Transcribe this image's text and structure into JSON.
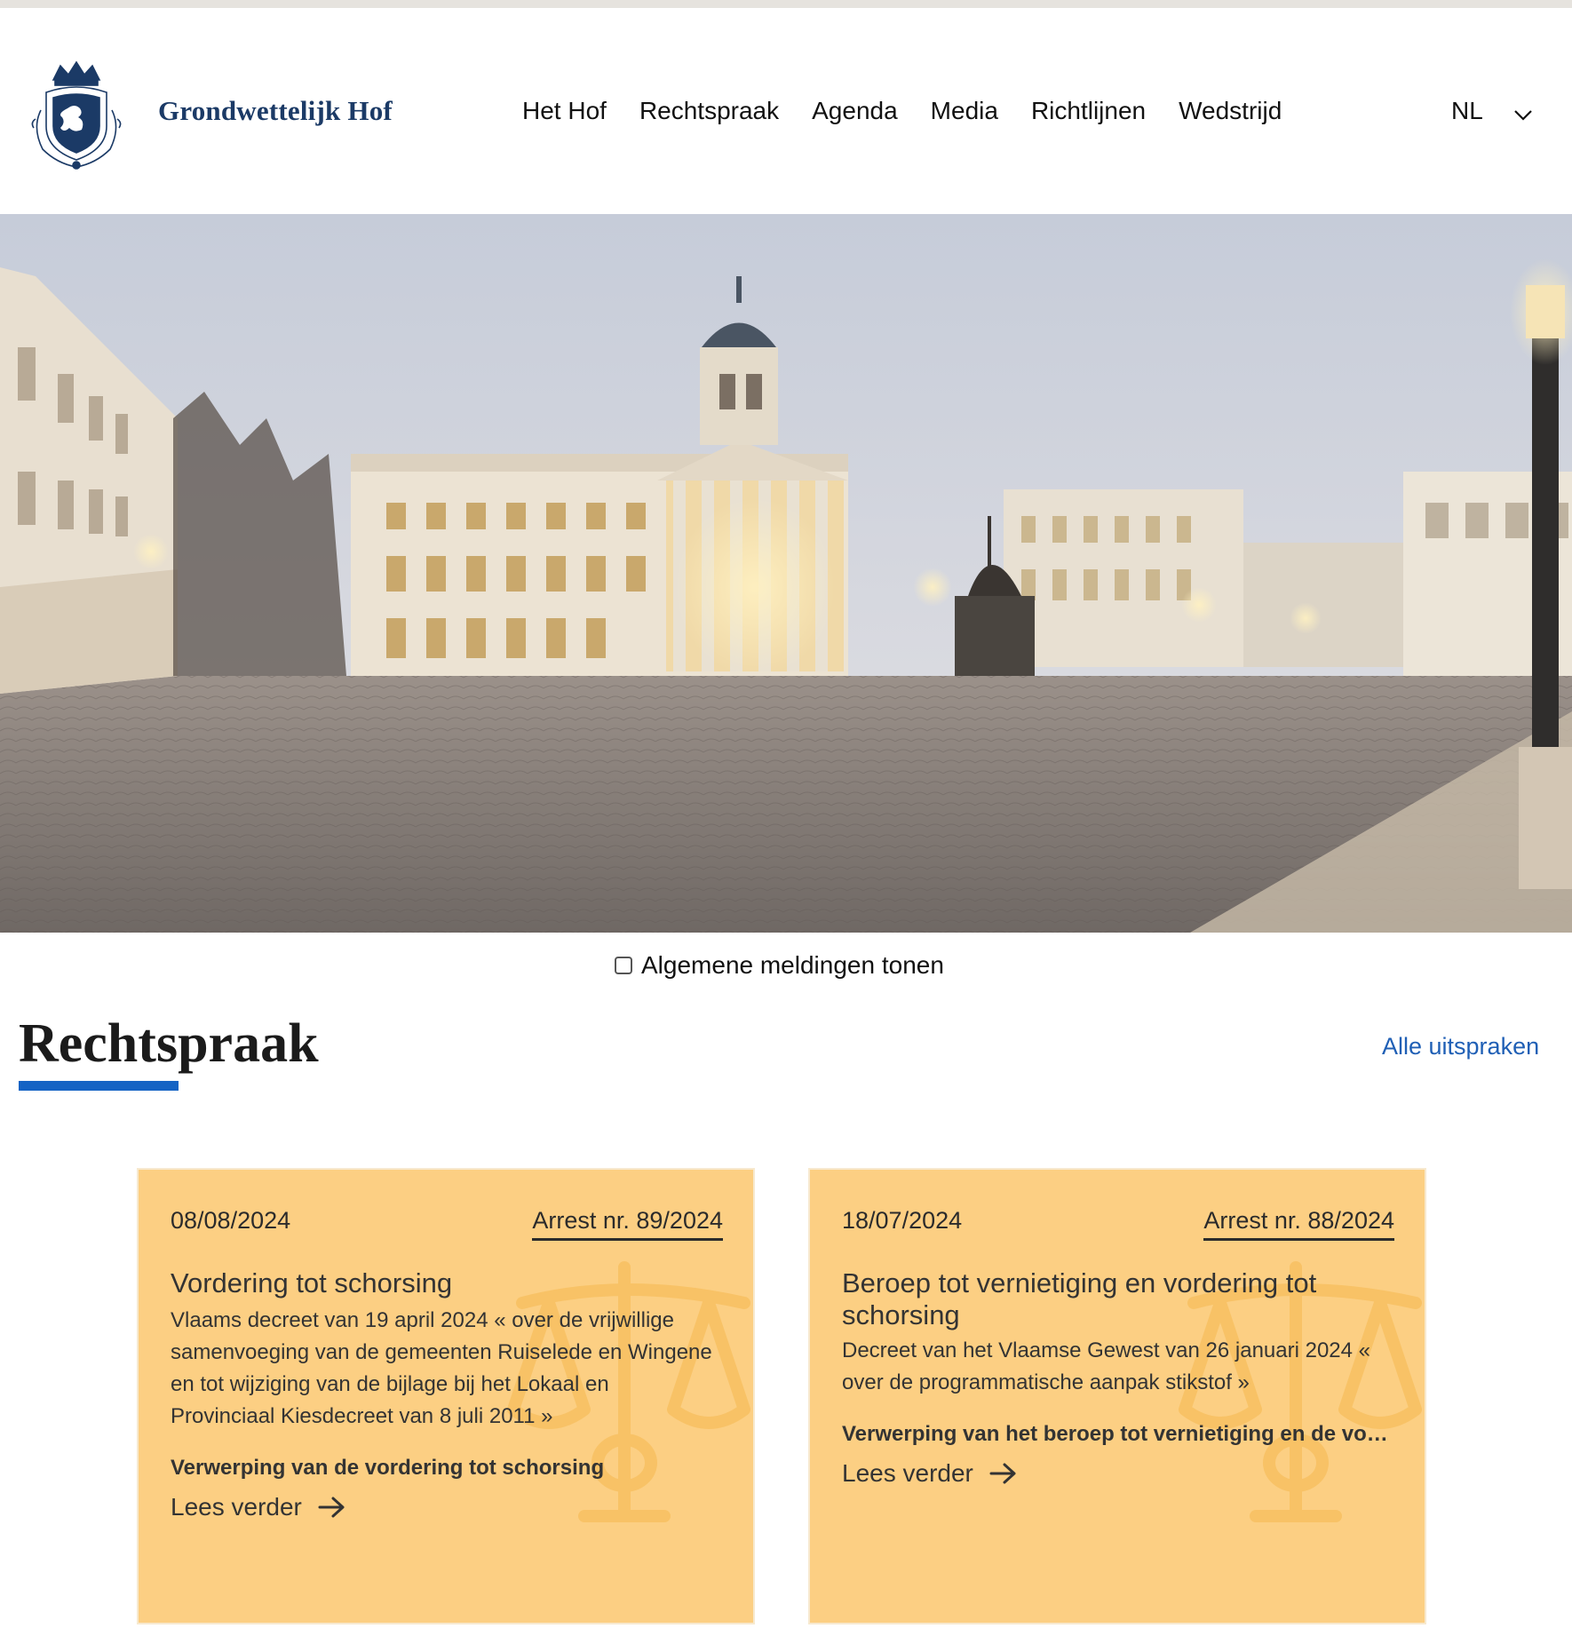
{
  "header": {
    "site_name": "Grondwettelijk Hof",
    "nav": [
      {
        "label": "Het Hof"
      },
      {
        "label": "Rechtspraak"
      },
      {
        "label": "Agenda"
      },
      {
        "label": "Media"
      },
      {
        "label": "Richtlijnen"
      },
      {
        "label": "Wedstrijd"
      }
    ],
    "language": "NL"
  },
  "notices": {
    "label": "Algemene meldingen tonen",
    "checked": false
  },
  "section": {
    "title": "Rechtspraak",
    "all_link": "Alle uitspraken"
  },
  "cards": [
    {
      "date": "08/08/2024",
      "arrest": "Arrest nr. 89/2024",
      "title": "Vordering tot schorsing",
      "description": "Vlaams decreet van 19 april 2024 « over de vrijwillige samenvoeging van de gemeenten Ruiselede en Wingene en tot wijziging van de bijlage bij het Lokaal en Provinciaal Kiesdecreet van 8 juli 2011 »",
      "result": "Verwerping van de vordering tot schorsing",
      "more": "Lees verder"
    },
    {
      "date": "18/07/2024",
      "arrest": "Arrest nr. 88/2024",
      "title": "Beroep tot vernietiging en vordering tot schorsing",
      "description": "Decreet van het Vlaamse Gewest van 26 januari 2024 « over de programmatische aanpak stikstof »",
      "result": "Verwerping van het beroep tot vernietiging en de vordering tot schorsing",
      "more": "Lees verder"
    }
  ],
  "colors": {
    "brand_navy": "#1b3a66",
    "accent_blue": "#1463c4",
    "link_blue": "#1f5fb5",
    "card_bg": "#fccf83"
  }
}
